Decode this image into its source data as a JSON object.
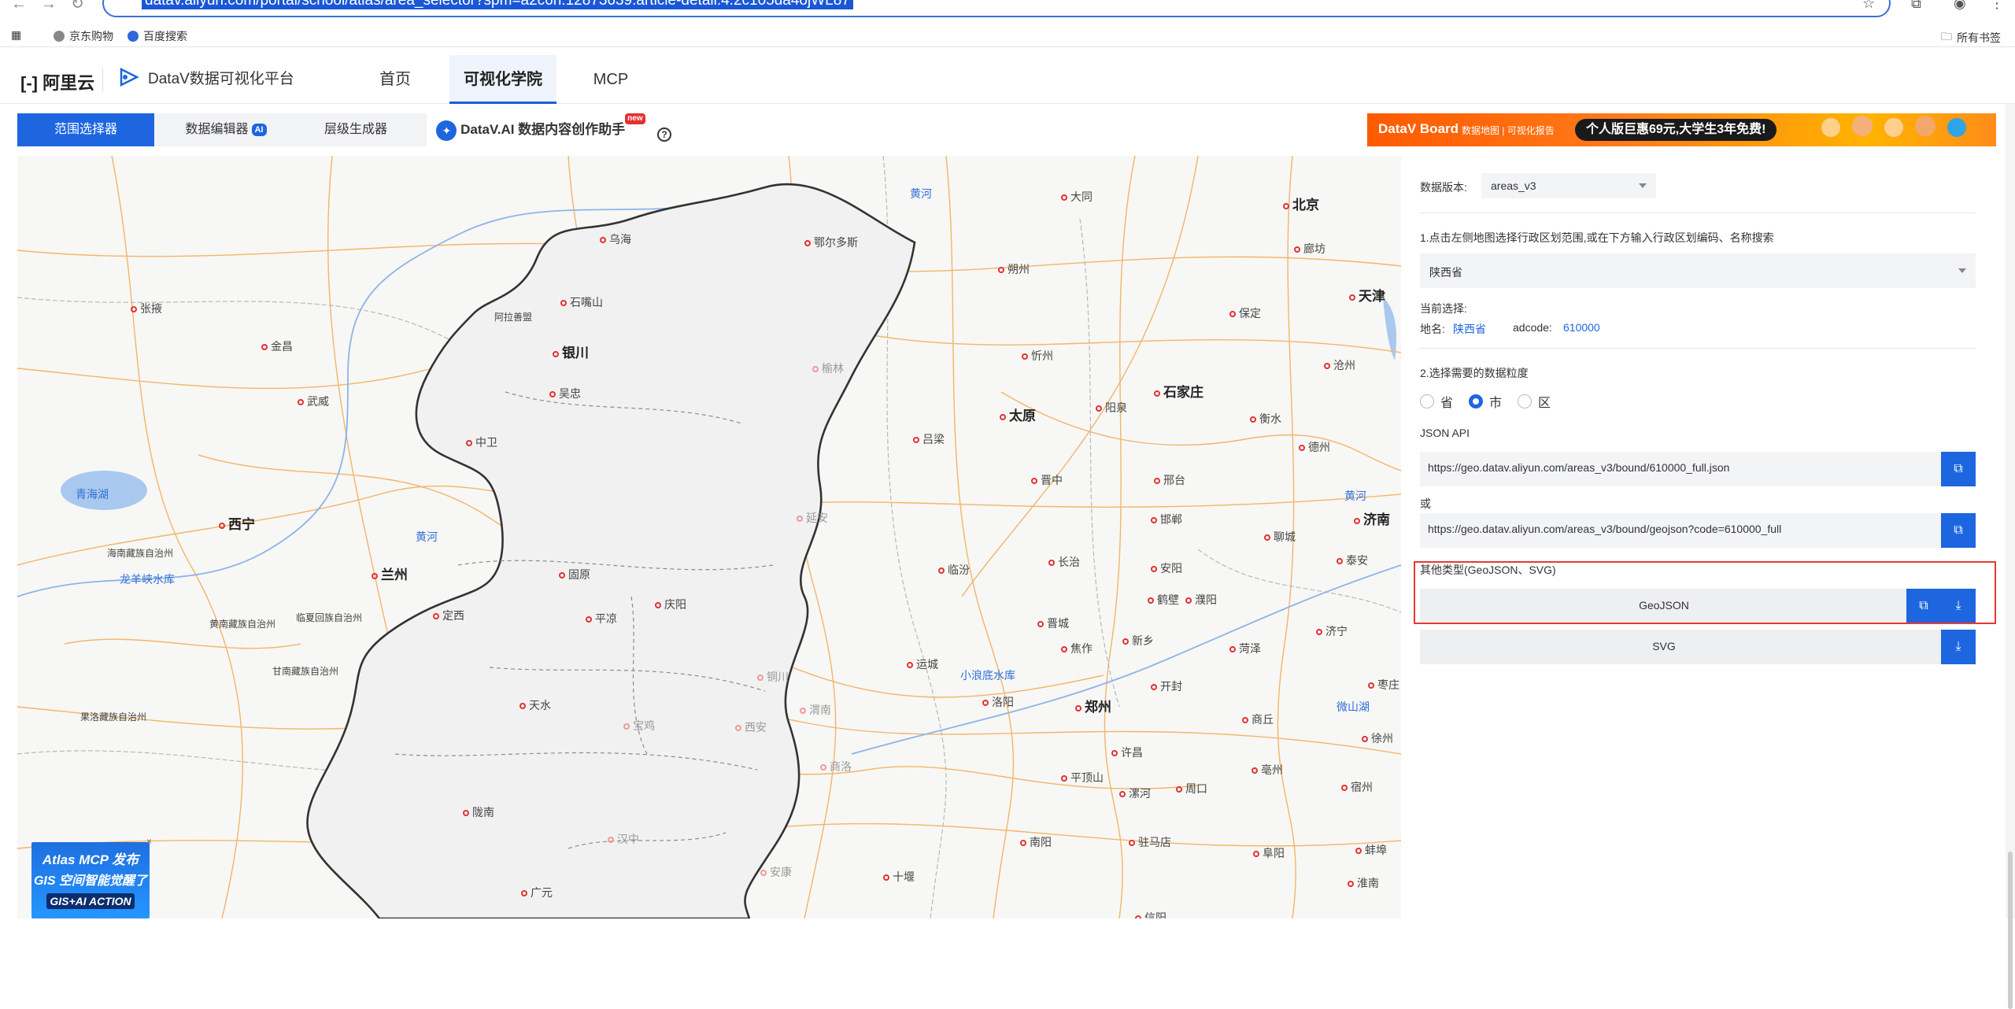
{
  "browser": {
    "url": "datav.aliyun.com/portal/school/atlas/area_selector?spm=a2c6h.12873639.article-detail.4.2c105da4ojWL87",
    "bookmarks": [
      "京东购物",
      "百度搜索"
    ],
    "bookmarks_folder": "所有书签"
  },
  "header": {
    "brand": "阿里云",
    "product": "DataV数据可视化平台",
    "nav": [
      "首页",
      "可视化学院",
      "MCP"
    ],
    "active_nav": "可视化学院"
  },
  "tabs": {
    "items": [
      "范围选择器",
      "数据编辑器",
      "层级生成器",
      "DataV.AI 数据内容创作助手"
    ],
    "ai_badge": "AI",
    "new_badge": "new",
    "help": "?"
  },
  "banner": {
    "title": "DataV Board",
    "subtitle": "数据地图 | 可视化报告",
    "promo": "个人版巨惠69元,大学生3年免费!"
  },
  "map": {
    "cities": [
      {
        "name": "乌海",
        "kind": "normal"
      },
      {
        "name": "鄂尔多斯",
        "kind": "normal"
      },
      {
        "name": "张掖",
        "kind": "normal"
      },
      {
        "name": "石嘴山",
        "kind": "normal"
      },
      {
        "name": "阿拉善盟",
        "kind": "normal"
      },
      {
        "name": "银川",
        "kind": "big"
      },
      {
        "name": "金昌",
        "kind": "normal"
      },
      {
        "name": "武威",
        "kind": "normal"
      },
      {
        "name": "吴忠",
        "kind": "normal"
      },
      {
        "name": "中卫",
        "kind": "normal"
      },
      {
        "name": "青海湖",
        "kind": "blue"
      },
      {
        "name": "西宁",
        "kind": "big"
      },
      {
        "name": "海南藏族自治州",
        "kind": "normal"
      },
      {
        "name": "龙羊峡水库",
        "kind": "blue"
      },
      {
        "name": "兰州",
        "kind": "big"
      },
      {
        "name": "黄河",
        "kind": "blue"
      },
      {
        "name": "固原",
        "kind": "normal"
      },
      {
        "name": "黄南藏族自治州",
        "kind": "normal"
      },
      {
        "name": "临夏回族自治州",
        "kind": "normal"
      },
      {
        "name": "定西",
        "kind": "normal"
      },
      {
        "name": "平凉",
        "kind": "normal"
      },
      {
        "name": "庆阳",
        "kind": "normal"
      },
      {
        "name": "甘南藏族自治州",
        "kind": "normal"
      },
      {
        "name": "果洛藏族自治州",
        "kind": "normal"
      },
      {
        "name": "天水",
        "kind": "normal"
      },
      {
        "name": "陇南",
        "kind": "normal"
      },
      {
        "name": "广元",
        "kind": "normal"
      },
      {
        "name": "榆林",
        "kind": "faint"
      },
      {
        "name": "延安",
        "kind": "faint"
      },
      {
        "name": "铜川",
        "kind": "faint"
      },
      {
        "name": "渭南",
        "kind": "faint"
      },
      {
        "name": "宝鸡",
        "kind": "faint"
      },
      {
        "name": "西安",
        "kind": "faint"
      },
      {
        "name": "商洛",
        "kind": "faint"
      },
      {
        "name": "汉中",
        "kind": "faint"
      },
      {
        "name": "安康",
        "kind": "faint"
      },
      {
        "name": "十堰",
        "kind": "normal"
      },
      {
        "name": "黄河",
        "kind": "blue"
      },
      {
        "name": "大同",
        "kind": "normal"
      },
      {
        "name": "朔州",
        "kind": "normal"
      },
      {
        "name": "忻州",
        "kind": "normal"
      },
      {
        "name": "太原",
        "kind": "big"
      },
      {
        "name": "吕梁",
        "kind": "normal"
      },
      {
        "name": "阳泉",
        "kind": "normal"
      },
      {
        "name": "晋中",
        "kind": "normal"
      },
      {
        "name": "临汾",
        "kind": "normal"
      },
      {
        "name": "长治",
        "kind": "normal"
      },
      {
        "name": "晋城",
        "kind": "normal"
      },
      {
        "name": "运城",
        "kind": "normal"
      },
      {
        "name": "小浪底水库",
        "kind": "blue"
      },
      {
        "name": "洛阳",
        "kind": "normal"
      },
      {
        "name": "郑州",
        "kind": "big"
      },
      {
        "name": "焦作",
        "kind": "normal"
      },
      {
        "name": "新乡",
        "kind": "normal"
      },
      {
        "name": "鹤壁",
        "kind": "normal"
      },
      {
        "name": "安阳",
        "kind": "normal"
      },
      {
        "name": "濮阳",
        "kind": "normal"
      },
      {
        "name": "开封",
        "kind": "normal"
      },
      {
        "name": "许昌",
        "kind": "normal"
      },
      {
        "name": "平顶山",
        "kind": "normal"
      },
      {
        "name": "漯河",
        "kind": "normal"
      },
      {
        "name": "周口",
        "kind": "normal"
      },
      {
        "name": "南阳",
        "kind": "normal"
      },
      {
        "name": "驻马店",
        "kind": "normal"
      },
      {
        "name": "信阳",
        "kind": "normal"
      },
      {
        "name": "北京",
        "kind": "big"
      },
      {
        "name": "廊坊",
        "kind": "normal"
      },
      {
        "name": "天津",
        "kind": "big"
      },
      {
        "name": "保定",
        "kind": "normal"
      },
      {
        "name": "石家庄",
        "kind": "big"
      },
      {
        "name": "沧州",
        "kind": "normal"
      },
      {
        "name": "衡水",
        "kind": "normal"
      },
      {
        "name": "德州",
        "kind": "normal"
      },
      {
        "name": "邢台",
        "kind": "normal"
      },
      {
        "name": "邯郸",
        "kind": "normal"
      },
      {
        "name": "聊城",
        "kind": "normal"
      },
      {
        "name": "济南",
        "kind": "big"
      },
      {
        "name": "黄河",
        "kind": "blue"
      },
      {
        "name": "泰安",
        "kind": "normal"
      },
      {
        "name": "济宁",
        "kind": "normal"
      },
      {
        "name": "菏泽",
        "kind": "normal"
      },
      {
        "name": "枣庄",
        "kind": "normal"
      },
      {
        "name": "商丘",
        "kind": "normal"
      },
      {
        "name": "微山湖",
        "kind": "blue"
      },
      {
        "name": "徐州",
        "kind": "normal"
      },
      {
        "name": "亳州",
        "kind": "normal"
      },
      {
        "name": "宿州",
        "kind": "normal"
      },
      {
        "name": "阜阳",
        "kind": "normal"
      },
      {
        "name": "蚌埠",
        "kind": "normal"
      },
      {
        "name": "淮南",
        "kind": "normal"
      }
    ]
  },
  "promo": {
    "line1": "Atlas MCP 发布",
    "line2": "GIS 空间智能觉醒了",
    "line3": "GIS+AI ACTION",
    "close": "×"
  },
  "panel": {
    "version_label": "数据版本:",
    "version_value": "areas_v3",
    "step1": "1.点击左侧地图选择行政区划范围,或在下方输入行政区划编码、名称搜索",
    "region_value": "陕西省",
    "current_label": "当前选择:",
    "name_label": "地名:",
    "name_value": "陕西省",
    "adcode_label": "adcode:",
    "adcode_value": "610000",
    "step2": "2.选择需要的数据粒度",
    "granularity": [
      "省",
      "市",
      "区"
    ],
    "granularity_selected": "市",
    "json_api_label": "JSON API",
    "api_url_1": "https://geo.datav.aliyun.com/areas_v3/bound/610000_full.json",
    "or_label": "或",
    "api_url_2": "https://geo.datav.aliyun.com/areas_v3/bound/geojson?code=610000_full",
    "other_label": "其他类型(GeoJSON、SVG)",
    "geojson_label": "GeoJSON",
    "svg_label": "SVG",
    "accent": "#1d66e0",
    "highlight": "#e53935"
  }
}
